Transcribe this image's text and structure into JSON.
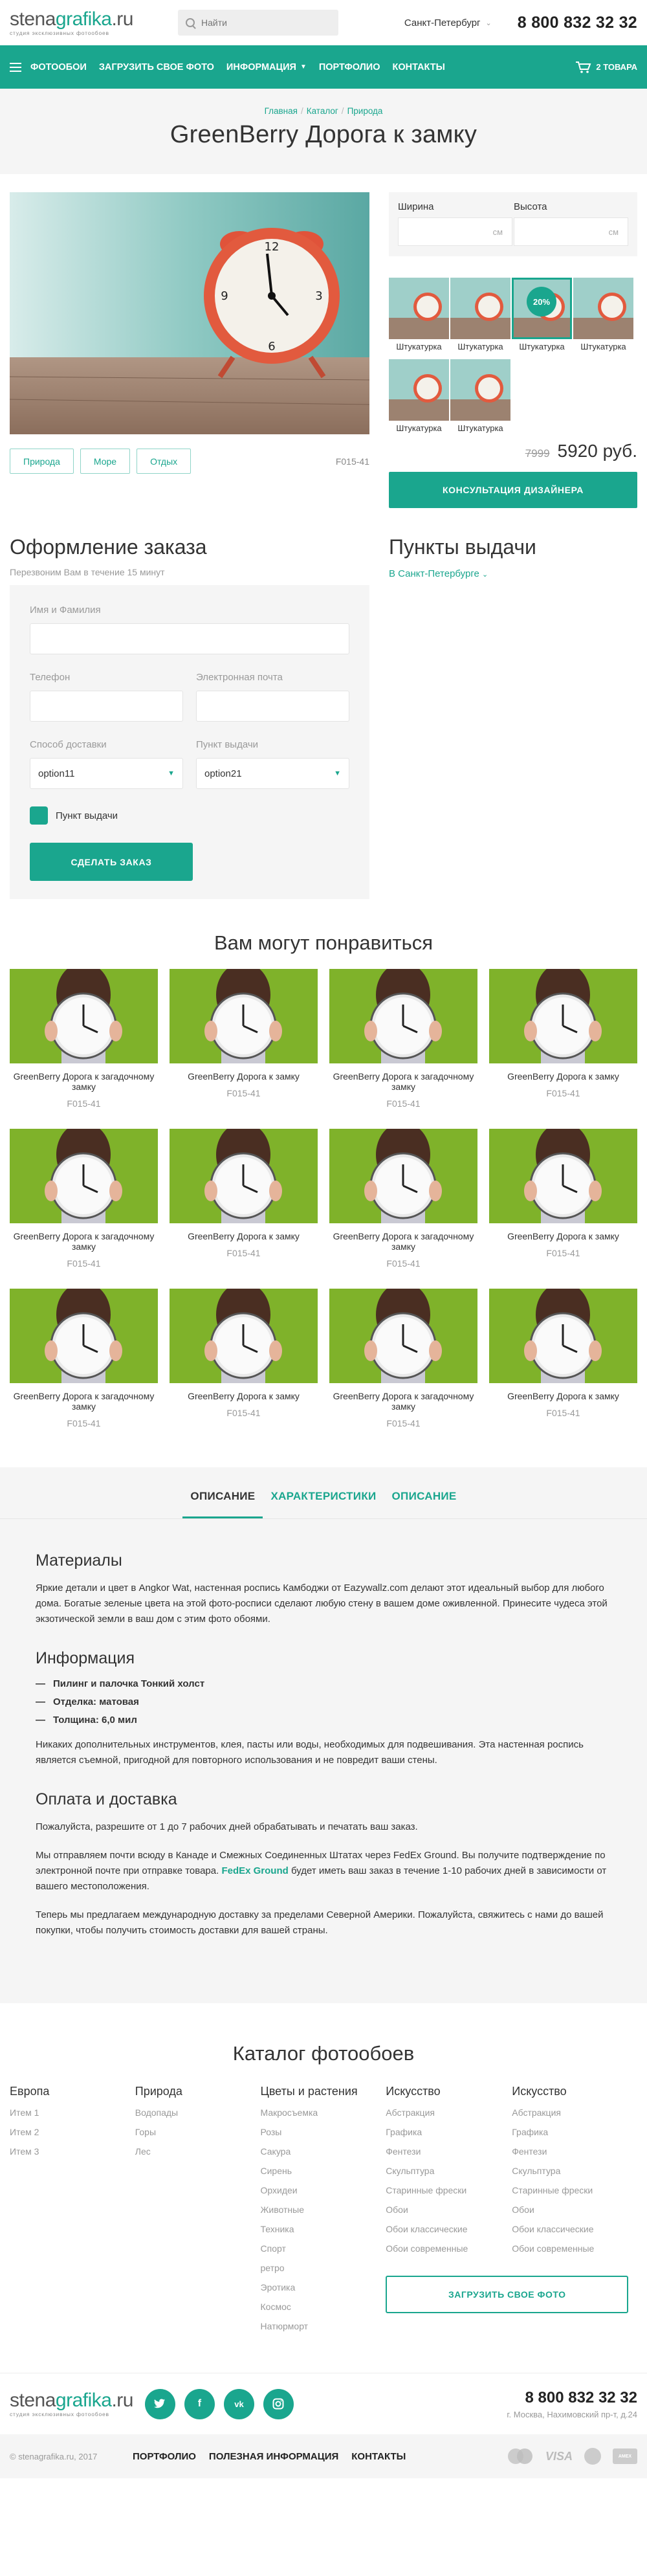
{
  "header": {
    "logo_main_1": "stena",
    "logo_main_2": "grafika",
    "logo_main_3": ".ru",
    "logo_sub": "студия эксклюзивных фотообоев",
    "search_placeholder": "Найти",
    "city": "Санкт-Петербург",
    "phone": "8 800 832 32 32"
  },
  "nav": {
    "items": [
      "ФОТООБОИ",
      "ЗАГРУЗИТЬ СВОЕ ФОТО",
      "ИНФОРМАЦИЯ",
      "ПОРТФОЛИО",
      "КОНТАКТЫ"
    ],
    "cart_label": "2 ТОВАРА"
  },
  "breadcrumb": [
    "Главная",
    "Каталог",
    "Природа"
  ],
  "page_title": "GreenBerry Дорога к замку",
  "product": {
    "tags": [
      "Природа",
      "Море",
      "Отдых"
    ],
    "sku": "F015-41",
    "width_label": "Ширина",
    "height_label": "Высота",
    "unit": "см",
    "textures": [
      "Штукатурка",
      "Штукатурка",
      "Штукатурка",
      "Штукатурка",
      "Штукатурка",
      "Штукатурка"
    ],
    "discount": "20%",
    "old_price": "7999",
    "price": "5920 руб.",
    "consult_button": "КОНСУЛЬТАЦИЯ ДИЗАЙНЕРА"
  },
  "order": {
    "title": "Оформление заказа",
    "subtitle": "Перезвоним Вам в течение 15 минут",
    "name_label": "Имя и Фамилия",
    "phone_label": "Телефон",
    "email_label": "Электронная почта",
    "delivery_label": "Способ доставки",
    "pickup_label": "Пункт выдачи",
    "delivery_value": "option11",
    "pickup_value": "option21",
    "checkbox_label": "Пункт выдачи",
    "submit": "СДЕЛАТЬ ЗАКАЗ"
  },
  "pickup": {
    "title": "Пункты выдачи",
    "city": "В Санкт-Петербурге"
  },
  "recommendations": {
    "title": "Вам могут понравиться",
    "items": [
      {
        "name": "GreenBerry Дорога к загадочному замку",
        "sku": "F015-41"
      },
      {
        "name": "GreenBerry Дорога к замку",
        "sku": "F015-41"
      },
      {
        "name": "GreenBerry Дорога к загадочному замку",
        "sku": "F015-41"
      },
      {
        "name": "GreenBerry Дорога к замку",
        "sku": "F015-41"
      },
      {
        "name": "GreenBerry Дорога к загадочному замку",
        "sku": "F015-41"
      },
      {
        "name": "GreenBerry Дорога к замку",
        "sku": "F015-41"
      },
      {
        "name": "GreenBerry Дорога к загадочному замку",
        "sku": "F015-41"
      },
      {
        "name": "GreenBerry Дорога к замку",
        "sku": "F015-41"
      },
      {
        "name": "GreenBerry Дорога к загадочному замку",
        "sku": "F015-41"
      },
      {
        "name": "GreenBerry Дорога к замку",
        "sku": "F015-41"
      },
      {
        "name": "GreenBerry Дорога к загадочному замку",
        "sku": "F015-41"
      },
      {
        "name": "GreenBerry Дорога к замку",
        "sku": "F015-41"
      }
    ]
  },
  "tabs": {
    "items": [
      "ОПИСАНИЕ",
      "ХАРАКТЕРИСТИКИ",
      "ОПИСАНИЕ"
    ],
    "materials_title": "Материалы",
    "materials_text": "Яркие детали и цвет в Angkor Wat, настенная роспись Камбоджи от Eazywallz.com делают этот идеальный выбор для любого дома. Богатые зеленые цвета на этой фото-росписи сделают любую стену в вашем доме оживленной. Принесите чудеса этой экзотической земли в ваш дом с этим фото обоями.",
    "info_title": "Информация",
    "info_list": [
      "Пилинг и палочка Тонкий холст",
      "Отделка: матовая",
      "Толщина: 6,0 мил"
    ],
    "info_text": "Никаких дополнительных инструментов, клея, пасты или воды, необходимых для подвешивания. Эта настенная роспись является съемной, пригодной для повторного использования и не повредит ваши стены.",
    "delivery_title": "Оплата и доставка",
    "delivery_p1": "Пожалуйста, разрешите от 1 до 7 рабочих дней обрабатывать и печатать ваш заказ.",
    "delivery_p2_a": "Мы отправляем почти всюду в Канаде и Смежных Соединенных Штатах через FedEx Ground. Вы получите подтверждение по электронной почте при отправке товара. ",
    "delivery_p2_link": "FedEx Ground",
    "delivery_p2_b": " будет иметь ваш заказ в течение 1-10 рабочих дней в зависимости от вашего местоположения.",
    "delivery_p3": "Теперь мы предлагаем международную доставку за пределами Северной Америки. Пожалуйста, свяжитесь с нами до вашей покупки, чтобы получить стоимость доставки для вашей страны."
  },
  "catalog": {
    "title": "Каталог фотообоев",
    "columns": [
      {
        "title": "Европа",
        "items": [
          "Итем 1",
          "Итем 2",
          "Итем 3"
        ]
      },
      {
        "title": "Природа",
        "items": [
          "Водопады",
          "Горы",
          "Лес"
        ]
      },
      {
        "title": "Цветы и растения",
        "items": [
          "Макросъемка",
          "Розы",
          "Сакура",
          "Сирень",
          "Орхидеи",
          "Животные",
          "Техника",
          "Спорт",
          "ретро",
          "Эротика",
          "Космос",
          "Натюрморт"
        ]
      },
      {
        "title": "Искусство",
        "items": [
          "Абстракция",
          "Графика",
          "Фентези",
          "Скульптура",
          "Старинные фрески",
          "Обои",
          "Обои классические",
          "Обои современные"
        ]
      },
      {
        "title": "Искусство",
        "items": [
          "Абстракция",
          "Графика",
          "Фентези",
          "Скульптура",
          "Старинные фрески",
          "Обои",
          "Обои классические",
          "Обои современные"
        ]
      }
    ],
    "upload_button": "ЗАГРУЗИТЬ СВОЕ ФОТО"
  },
  "footer": {
    "phone": "8 800 832 32 32",
    "address": "г. Москва, Нахимовский пр-т, д.24",
    "copyright": "© stenagrafika.ru, 2017",
    "nav": [
      "ПОРТФОЛИО",
      "ПОЛЕЗНАЯ ИНФОРМАЦИЯ",
      "КОНТАКТЫ"
    ],
    "socials": [
      "twitter-icon",
      "facebook-icon",
      "vk-icon",
      "instagram-icon"
    ],
    "payments": [
      "mastercard-icon",
      "VISA",
      "apple-pay-icon",
      "american-express-icon"
    ],
    "amex_label": "AMEX"
  },
  "colors": {
    "accent": "#1aa68e",
    "bg_light": "#f5f5f5"
  }
}
